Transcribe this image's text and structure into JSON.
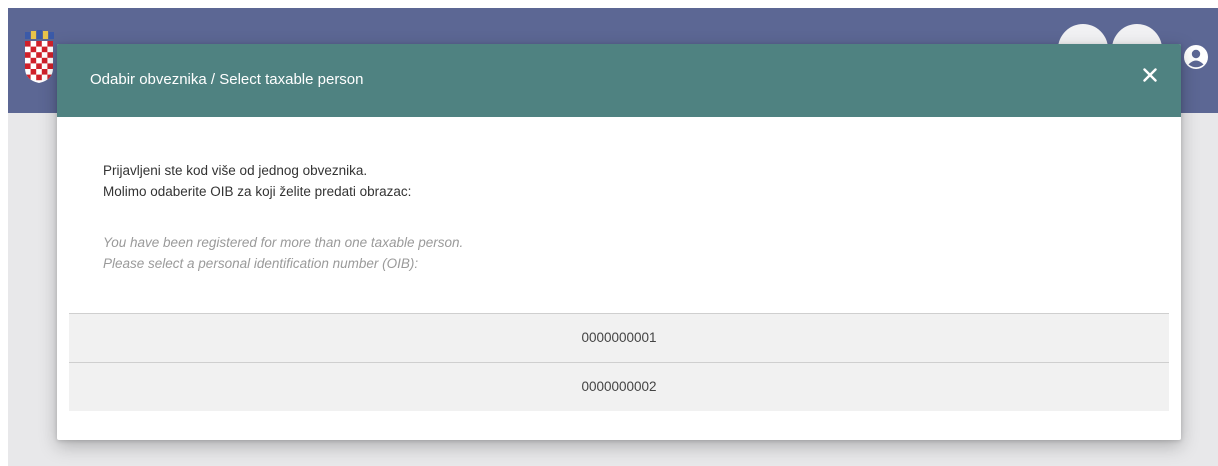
{
  "app": {
    "header_color": "#5c6794",
    "icons": [
      "croatian-coat-of-arms-icon",
      "user-circle-icon"
    ]
  },
  "modal": {
    "title": "Odabir obveznika / Select taxable person",
    "header_color": "#4f8281",
    "close_icon": "close-icon",
    "message_hr": [
      "Prijavljeni ste kod više od jednog obveznika.",
      "Molimo odaberite OIB za koji želite predati obrazac:"
    ],
    "message_en": [
      "You have been registered for more than one taxable person.",
      "Please select a personal identification number (OIB):"
    ],
    "oib_options": [
      "0000000001",
      "0000000002"
    ]
  }
}
